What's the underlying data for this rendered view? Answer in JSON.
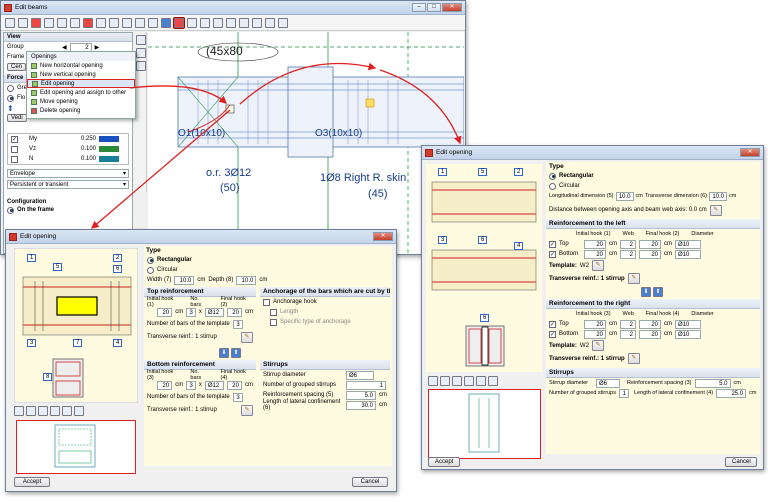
{
  "main_window": {
    "title": "Edit beams",
    "left_panel": {
      "view_label": "View",
      "group_label": "Group",
      "group_value": "2",
      "frame_label": "Frame",
      "cen_label": "Cen",
      "forces_label": "Force",
      "gr_label": "Gre",
      "flo_label": "Flo",
      "vedic_label": "Vedi",
      "table_rows": [
        {
          "name": "My",
          "value": "0.250",
          "checked": true
        },
        {
          "name": "Vz",
          "value": "0.100",
          "checked": false
        },
        {
          "name": "N",
          "value": "0.100",
          "checked": false
        }
      ],
      "envelope_label": "Envelope",
      "persistent_label": "Persistent or transient",
      "configuration_label": "Configuration",
      "on_frame_label": "On the frame"
    },
    "openings_menu": {
      "title": "Openings",
      "items": [
        "New horizontal opening",
        "New vertical opening",
        "Edit opening",
        "Edit opening and assign to other",
        "Move opening",
        "Delete opening"
      ]
    },
    "drawing": {
      "section_label": "(45x80",
      "opening1_label": "O1(10x10)",
      "opening3_label": "O3(10x10)",
      "rebar_label1": "o.r. 3Ø12",
      "rebar_label1b": "(50)",
      "rebar_label2": "1Ø8 Right R. skin",
      "rebar_label2b": "(45)"
    }
  },
  "dialog_left": {
    "title": "Edit opening",
    "type_label": "Type",
    "rectangular": "Rectangular",
    "circular": "Circular",
    "width_label": "Width (7)",
    "width_value": "10.0",
    "depth_label": "Depth (8)",
    "depth_value": "10.0",
    "unit_cm": "cm",
    "top_reinf_title": "Top reinforcement",
    "initial_hook_1": "Initial hook (1)",
    "no_bars": "No. bars",
    "final_hook_2": "Final hook (2)",
    "top_initial": "20",
    "top_nbars": "3",
    "top_diam": "Ø12",
    "top_final": "20",
    "nbars_template_label": "Number of bars of the template",
    "top_template_nbars": "3",
    "transverse_label": "Transverse reinf.: 1 stirrup",
    "anchorage_title": "Anchorage of the bars which are cut by the opening",
    "anchorage_hook": "Anchorage hook",
    "length_label": "Length",
    "specific_anchorage": "Specific type of anchorage",
    "bottom_reinf_title": "Bottom reinforcement",
    "initial_hook_3": "Initial hook (3)",
    "final_hook_4": "Final hook (4)",
    "bot_initial": "20",
    "bot_nbars": "3",
    "bot_diam": "Ø12",
    "bot_final": "20",
    "bot_template_nbars": "3",
    "stirrups_title": "Stirrups",
    "stirrup_diameter_label": "Stirrup diameter",
    "stirrup_diameter": "Ø6",
    "grouped_label": "Number of grouped stirrups",
    "grouped_value": "1",
    "spacing_label": "Reinforcement spacing (5)",
    "spacing_value": "5.0",
    "lateral_label": "Length of lateral confinement (6)",
    "lateral_value": "30.0",
    "multiply": "x",
    "diagram_nums": [
      "1",
      "2",
      "5",
      "6",
      "3",
      "7",
      "4",
      "8"
    ],
    "accept": "Accept",
    "cancel": "Cancel"
  },
  "dialog_right": {
    "title": "Edit opening",
    "type_label": "Type",
    "rectangular": "Rectangular",
    "circular": "Circular",
    "long_dim_label": "Longitudinal dimension (5)",
    "long_dim_value": "10.0",
    "trans_dim_label": "Transverse dimension (6)",
    "trans_dim_value": "10.0",
    "unit_cm": "cm",
    "distance_label": "Distance between opening axis and beam web axis: 0.0 cm",
    "left_title": "Reinforcement to the left",
    "initial_hook_1": "Initial hook (1)",
    "web": "Web",
    "final_hook_2": "Final hook (2)",
    "diameter": "Diameter",
    "top": "Top",
    "bottom": "Bottom",
    "left_top_initial": "20",
    "left_top_web": "2",
    "left_top_final": "20",
    "left_top_diam": "Ø10",
    "left_bot_initial": "20",
    "left_bot_web": "2",
    "left_bot_final": "20",
    "left_bot_diam": "Ø10",
    "template_label": "Template:",
    "template_value": "W2",
    "transverse_label": "Transverse reinf.: 1 stirrup",
    "right_title": "Reinforcement to the right",
    "initial_hook_3": "Initial hook (3)",
    "final_hook_4": "Final hook (4)",
    "right_top_initial": "20",
    "right_top_web": "2",
    "right_top_final": "20",
    "right_top_diam": "Ø10",
    "right_bot_initial": "20",
    "right_bot_web": "2",
    "right_bot_final": "20",
    "right_bot_diam": "Ø10",
    "stirrups_title": "Stirrups",
    "stirrup_diameter_label": "Stirrup diameter",
    "stirrup_diameter": "Ø6",
    "spacing_label": "Reinforcement spacing (3)",
    "spacing_value": "5.0",
    "grouped_label": "Number of grouped stirrups",
    "grouped_value": "1",
    "lateral_label": "Length of lateral confinement (4)",
    "lateral_value": "25.0",
    "diagram_nums": [
      "1",
      "5",
      "2",
      "3",
      "6",
      "4",
      "6"
    ],
    "accept": "Accept",
    "cancel": "Cancel"
  },
  "colors": {
    "highlight_red": "#e02020",
    "accent_blue": "#3b6fc4",
    "titlebar": "#c2d3ea"
  }
}
